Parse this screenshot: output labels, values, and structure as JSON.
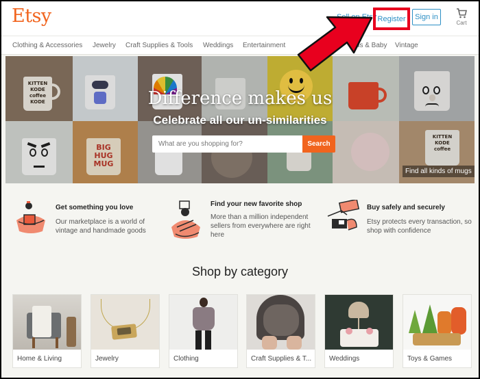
{
  "header": {
    "logo": "Etsy",
    "sell_label": "Sell on Etsy",
    "register_label": "Register",
    "signin_label": "Sign in",
    "cart_label": "Cart",
    "cart_icon": "cart-icon"
  },
  "nav": {
    "items": [
      "Clothing & Accessories",
      "Jewelry",
      "Craft Supplies & Tools",
      "Weddings",
      "Entertainment",
      "Kids & Baby",
      "Vintage"
    ]
  },
  "hero": {
    "title": "Difference makes us",
    "subtitle": "Celebrate all our un-similarities",
    "search_placeholder": "What are you shopping for?",
    "search_button": "Search",
    "caption": "Find all kinds of mugs",
    "mug_text_1": "KITTEN\nKODE\ncoffee\nKODE",
    "mug_text_2": "BIG\nHUG\nMUG",
    "mug_text_3": "KITTEN\nKODE\ncoffee"
  },
  "benefits": [
    {
      "title": "Get something you love",
      "body": "Our marketplace is a world of vintage and handmade goods"
    },
    {
      "title": "Find your new favorite shop",
      "body": "More than a million independent sellers from everywhere are right here"
    },
    {
      "title": "Buy safely and securely",
      "body": "Etsy protects every transaction, so shop with confidence"
    }
  ],
  "categories": {
    "title": "Shop by category",
    "items": [
      "Home & Living",
      "Jewelry",
      "Clothing",
      "Craft Supplies & T...",
      "Weddings",
      "Toys & Games"
    ]
  },
  "colors": {
    "brand_orange": "#f1641e",
    "link_blue": "#2a8ec4",
    "highlight_red": "#e8001e",
    "page_bg": "#f5f5f1"
  }
}
